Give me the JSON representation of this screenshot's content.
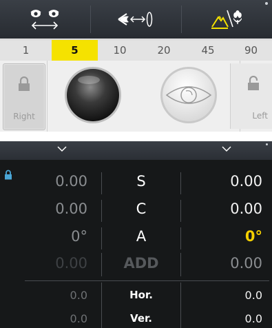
{
  "toolbar": {
    "icons": [
      "binocular-swap-icon",
      "eye-lens-distance-icon",
      "near-far-vision-icon"
    ],
    "accent_color": "#f5e200"
  },
  "distance_strip": {
    "values": [
      "1",
      "5",
      "10",
      "20",
      "45",
      "90"
    ],
    "selected": "5"
  },
  "lens_area": {
    "right_label": "Right",
    "left_label": "Left"
  },
  "refraction": {
    "rows": [
      {
        "left": "0.00",
        "label": "S",
        "right": "0.00"
      },
      {
        "left": "0.00",
        "label": "C",
        "right": "0.00"
      },
      {
        "left": "0°",
        "label": "A",
        "right": "0°"
      },
      {
        "left": "0.00",
        "label": "ADD",
        "right": "0.00"
      },
      {
        "left": "0.0",
        "label": "Hor.",
        "right": "0.0"
      },
      {
        "left": "0.0",
        "label": "Ver.",
        "right": "0.0"
      }
    ],
    "highlight_color": "#f5d000"
  }
}
